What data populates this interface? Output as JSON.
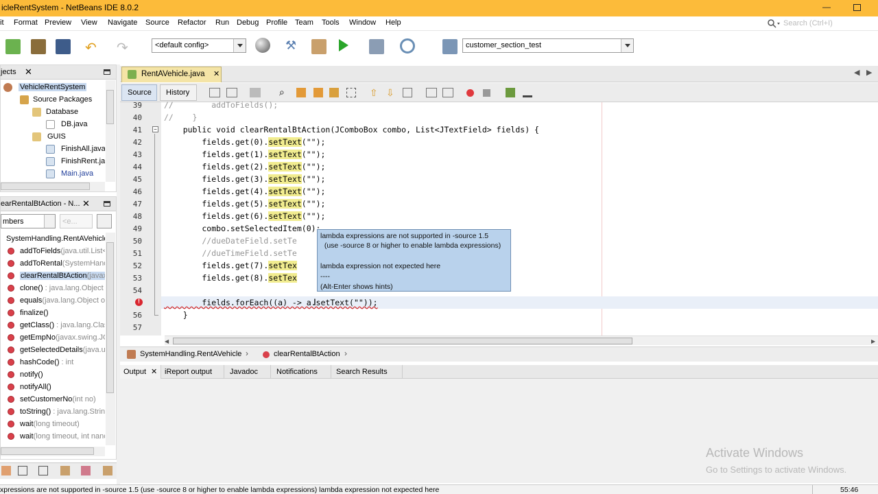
{
  "window": {
    "title": "icleRentSystem - NetBeans IDE 8.0.2"
  },
  "menu": [
    "Format",
    "Preview",
    "View",
    "Navigate",
    "Source",
    "Refactor",
    "Run",
    "Debug",
    "Profile",
    "Team",
    "Tools",
    "Window",
    "Help"
  ],
  "menu_first": "it",
  "search": {
    "placeholder": "Search (Ctrl+I)"
  },
  "toolbar": {
    "config_value": "<default config>",
    "project_value": "customer_section_test"
  },
  "projects_panel": {
    "tab": "jects",
    "tree": [
      {
        "label": "VehicleRentSystem",
        "selected": true
      },
      {
        "label": "Source Packages"
      },
      {
        "label": "Database"
      },
      {
        "label": "DB.java"
      },
      {
        "label": "GUIS"
      },
      {
        "label": "FinishAll.java"
      },
      {
        "label": "FinishRent.jav"
      },
      {
        "label": "Main.java"
      }
    ]
  },
  "navigator_panel": {
    "tab": "earRentalBtAction - N...",
    "filter_value": "mbers",
    "filter2_value": "<e...",
    "class_label": "SystemHandling.RentAVehicle",
    "members": [
      {
        "name": "addToFields",
        "sig": "(java.util.List<"
      },
      {
        "name": "addToRental",
        "sig": "(SystemHand"
      },
      {
        "name": "clearRentalBtAction",
        "sig": "(javax",
        "selected": true
      },
      {
        "name": "clone()",
        "sig": " : java.lang.Object"
      },
      {
        "name": "equals",
        "sig": "(java.lang.Object ol"
      },
      {
        "name": "finalize()",
        "sig": ""
      },
      {
        "name": "getClass()",
        "sig": " : java.lang.Clas"
      },
      {
        "name": "getEmpNo",
        "sig": "(javax.swing.JC"
      },
      {
        "name": "getSelectedDetails",
        "sig": "(java.ut"
      },
      {
        "name": "hashCode()",
        "sig": " : int"
      },
      {
        "name": "notify()",
        "sig": ""
      },
      {
        "name": "notifyAll()",
        "sig": ""
      },
      {
        "name": "setCustomerNo",
        "sig": "(int no)"
      },
      {
        "name": "toString()",
        "sig": " : java.lang.String"
      },
      {
        "name": "wait",
        "sig": "(long timeout)"
      },
      {
        "name": "wait",
        "sig": "(long timeout, int nanc"
      }
    ]
  },
  "editor": {
    "file_tab": "RentAVehicle.java",
    "source_tab": "Source",
    "history_tab": "History",
    "lines": [
      {
        "n": "39",
        "text": "//        addToFields();",
        "comment": true
      },
      {
        "n": "40",
        "text": "//    }",
        "comment": true
      },
      {
        "n": "41",
        "text": "    public void clearRentalBtAction(JComboBox combo, List<JTextField> fields) {"
      },
      {
        "n": "42",
        "pre": "        fields.get(0).",
        "hl": "setText",
        "post": "(\"\");"
      },
      {
        "n": "43",
        "pre": "        fields.get(1).",
        "hl": "setText",
        "post": "(\"\");"
      },
      {
        "n": "44",
        "pre": "        fields.get(2).",
        "hl": "setText",
        "post": "(\"\");"
      },
      {
        "n": "45",
        "pre": "        fields.get(3).",
        "hl": "setText",
        "post": "(\"\");"
      },
      {
        "n": "46",
        "pre": "        fields.get(4).",
        "hl": "setText",
        "post": "(\"\");"
      },
      {
        "n": "47",
        "pre": "        fields.get(5).",
        "hl": "setText",
        "post": "(\"\");"
      },
      {
        "n": "48",
        "pre": "        fields.get(6).",
        "hl": "setText",
        "post": "(\"\");"
      },
      {
        "n": "49",
        "text": "        combo.setSelectedItem(0);"
      },
      {
        "n": "50",
        "text": "        //dueDateField.setTe",
        "comment": true
      },
      {
        "n": "51",
        "text": "        //dueTimeField.setTe",
        "comment": true
      },
      {
        "n": "52",
        "pre": "        fields.get(7).",
        "hl": "setTex",
        "post": ""
      },
      {
        "n": "53",
        "pre": "        fields.get(8).",
        "hl": "setTex",
        "post": ""
      },
      {
        "n": "54",
        "text": ""
      },
      {
        "n": "",
        "text": "        fields.forEach((a) -> a.setText(\"\"));",
        "error": true
      },
      {
        "n": "56",
        "text": "    }"
      },
      {
        "n": "57",
        "text": ""
      }
    ],
    "tooltip": [
      "lambda expressions are not supported in -source 1.5",
      "  (use -source 8 or higher to enable lambda expressions)",
      "",
      "lambda expression not expected here",
      "----",
      "(Alt-Enter shows hints)"
    ]
  },
  "breadcrumb": {
    "class": "SystemHandling.RentAVehicle",
    "method": "clearRentalBtAction"
  },
  "output_tabs": [
    "Output",
    "iReport output",
    "Javadoc",
    "Notifications",
    "Search Results"
  ],
  "watermark": {
    "line1": "Activate Windows",
    "line2": "Go to Settings to activate Windows."
  },
  "status": {
    "message": "xpressions are not supported in -source 1.5   (use -source 8 or higher to enable lambda expressions)  lambda expression not expected here",
    "time": "55:46"
  }
}
